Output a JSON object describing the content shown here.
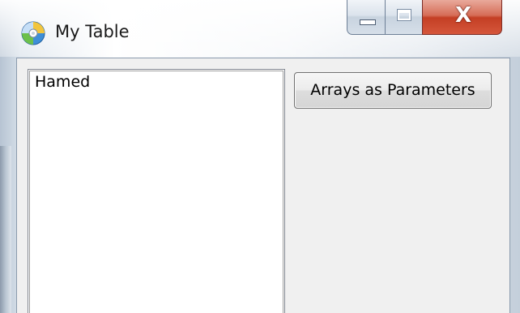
{
  "window": {
    "title": "My Table",
    "icon": "app-disc-icon"
  },
  "caption_buttons": {
    "minimize_icon": "minimize-icon",
    "maximize_icon": "maximize-icon",
    "close_glyph": "X"
  },
  "list": {
    "items": [
      "Hamed"
    ]
  },
  "button": {
    "label": "Arrays as Parameters"
  },
  "colors": {
    "close_button": "#c94a2f",
    "client_background": "#f0f0f0",
    "list_background": "#ffffff"
  }
}
